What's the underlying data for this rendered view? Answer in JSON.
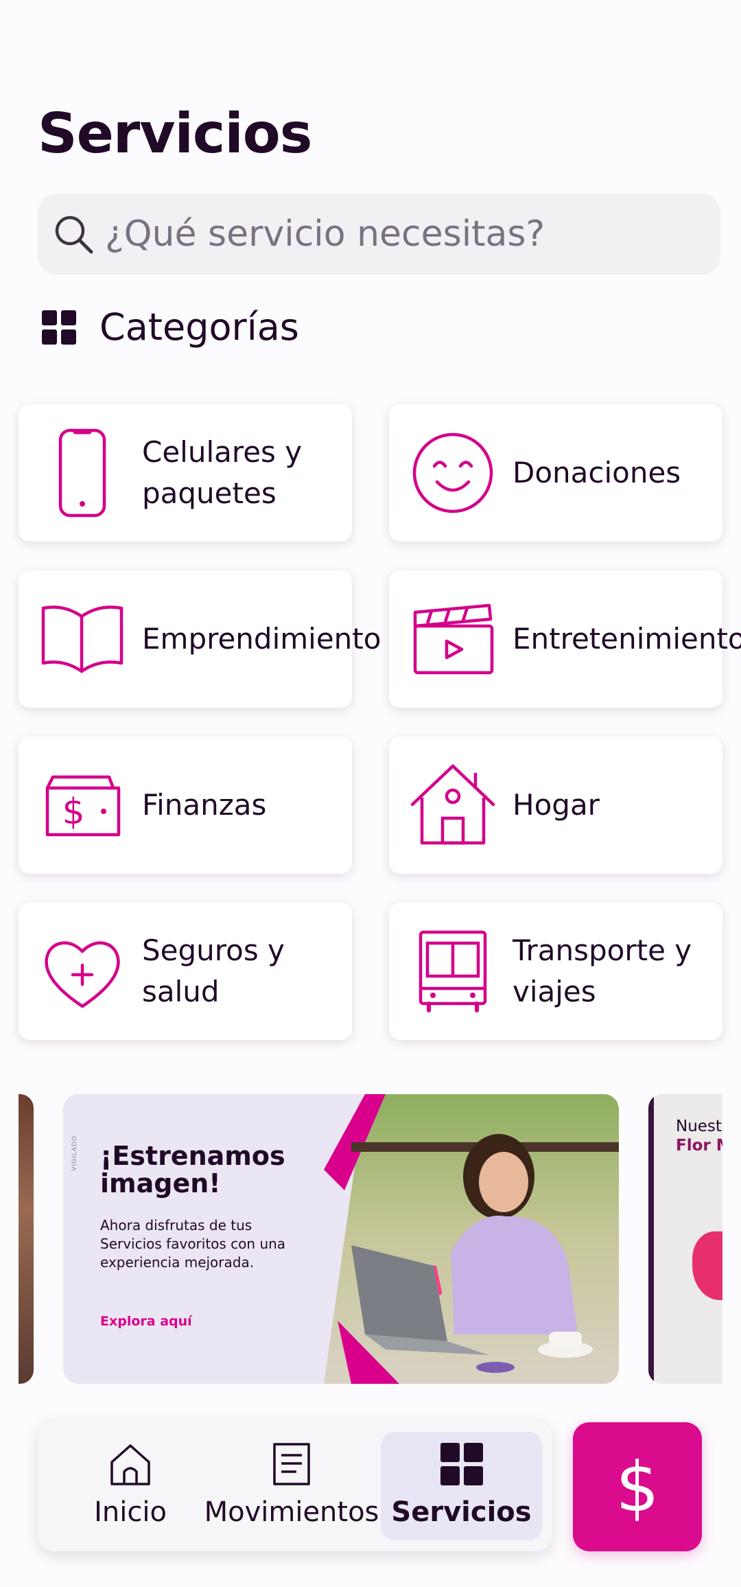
{
  "header": {
    "title": "Servicios"
  },
  "search": {
    "placeholder": "¿Qué servicio necesitas?"
  },
  "categories": {
    "heading": "Categorías",
    "icon": "grid-icon",
    "items": [
      {
        "label": "Celulares y\npaquetes",
        "icon": "phone-icon"
      },
      {
        "label": "Donaciones",
        "icon": "smile-icon"
      },
      {
        "label": "Emprendimiento",
        "icon": "book-icon"
      },
      {
        "label": "Entretenimiento",
        "icon": "clapperboard-icon"
      },
      {
        "label": "Finanzas",
        "icon": "wallet-icon"
      },
      {
        "label": "Hogar",
        "icon": "house-icon"
      },
      {
        "label": "Seguros y\nsalud",
        "icon": "heart-plus-icon"
      },
      {
        "label": "Transporte y\nviajes",
        "icon": "bus-icon"
      }
    ]
  },
  "carousel": {
    "banner": {
      "title": "¡Estrenamos imagen!",
      "text": "Ahora disfrutas de tus Servicios favoritos con una experiencia mejorada.",
      "link": "Explora aquí",
      "vigilado": "VIGILADO"
    },
    "next_banner": {
      "line1": "Nuest",
      "line2": "Flor M"
    }
  },
  "nav": {
    "items": [
      {
        "label": "Inicio",
        "icon": "home-icon"
      },
      {
        "label": "Movimientos",
        "icon": "receipt-icon"
      },
      {
        "label": "Servicios",
        "icon": "grid-icon"
      }
    ],
    "pay_symbol": "$"
  },
  "colors": {
    "accent": "#D4008A",
    "text": "#200A27",
    "background": "#FCFBFD",
    "pay_button": "#DA0B8C"
  }
}
